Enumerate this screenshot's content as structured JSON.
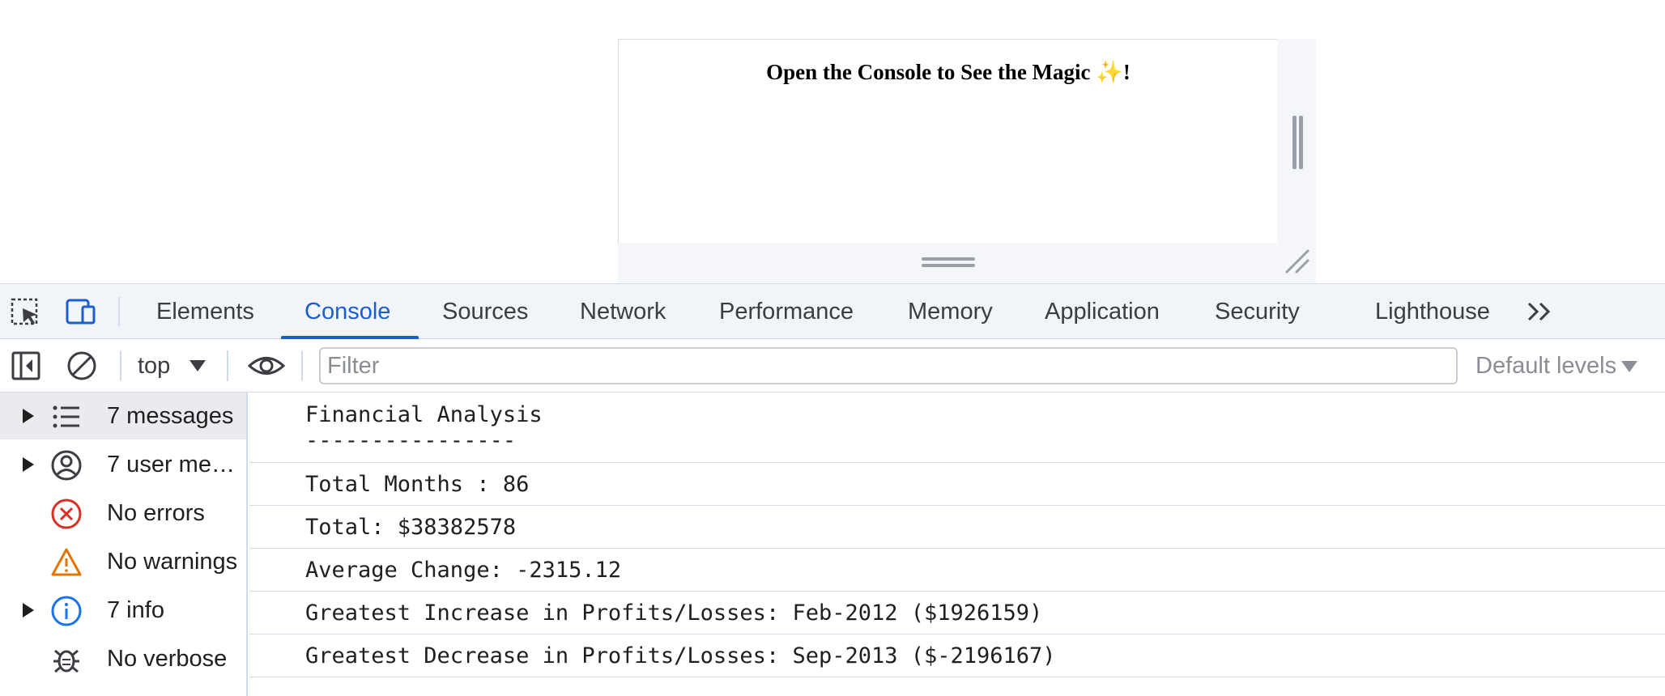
{
  "page": {
    "heading": "Open the Console to See the Magic",
    "heading_emoji": "✨",
    "heading_tail": "!"
  },
  "devtools": {
    "tabs": [
      {
        "label": "Elements",
        "active": false
      },
      {
        "label": "Console",
        "active": true
      },
      {
        "label": "Sources",
        "active": false
      },
      {
        "label": "Network",
        "active": false
      },
      {
        "label": "Performance",
        "active": false
      },
      {
        "label": "Memory",
        "active": false
      },
      {
        "label": "Application",
        "active": false
      },
      {
        "label": "Security",
        "active": false
      },
      {
        "label": "Lighthouse",
        "active": false
      }
    ],
    "more_tabs_icon": "chevron-double-right-icon",
    "toolbar": {
      "context": "top",
      "filter_placeholder": "Filter",
      "levels_label": "Default levels"
    },
    "sidebar": [
      {
        "label": "7 messages",
        "icon": "list-icon",
        "expandable": true,
        "selected": true
      },
      {
        "label": "7 user messages",
        "icon": "user-icon",
        "expandable": true,
        "selected": false
      },
      {
        "label": "No errors",
        "icon": "error-icon",
        "expandable": false,
        "selected": false
      },
      {
        "label": "No warnings",
        "icon": "warning-icon",
        "expandable": false,
        "selected": false
      },
      {
        "label": "7 info",
        "icon": "info-icon",
        "expandable": true,
        "selected": false
      },
      {
        "label": "No verbose",
        "icon": "bug-icon",
        "expandable": false,
        "selected": false
      }
    ],
    "console_messages": [
      "Financial Analysis\n----------------",
      "Total Months : 86",
      "Total: $38382578",
      "Average Change: -2315.12",
      "Greatest Increase in Profits/Losses: Feb-2012 ($1926159)",
      "Greatest Decrease in Profits/Losses: Sep-2013 ($-2196167)"
    ],
    "colors": {
      "accent": "#1a5fd0",
      "error": "#d93025",
      "warning": "#e37400",
      "info": "#1a73e8"
    }
  }
}
